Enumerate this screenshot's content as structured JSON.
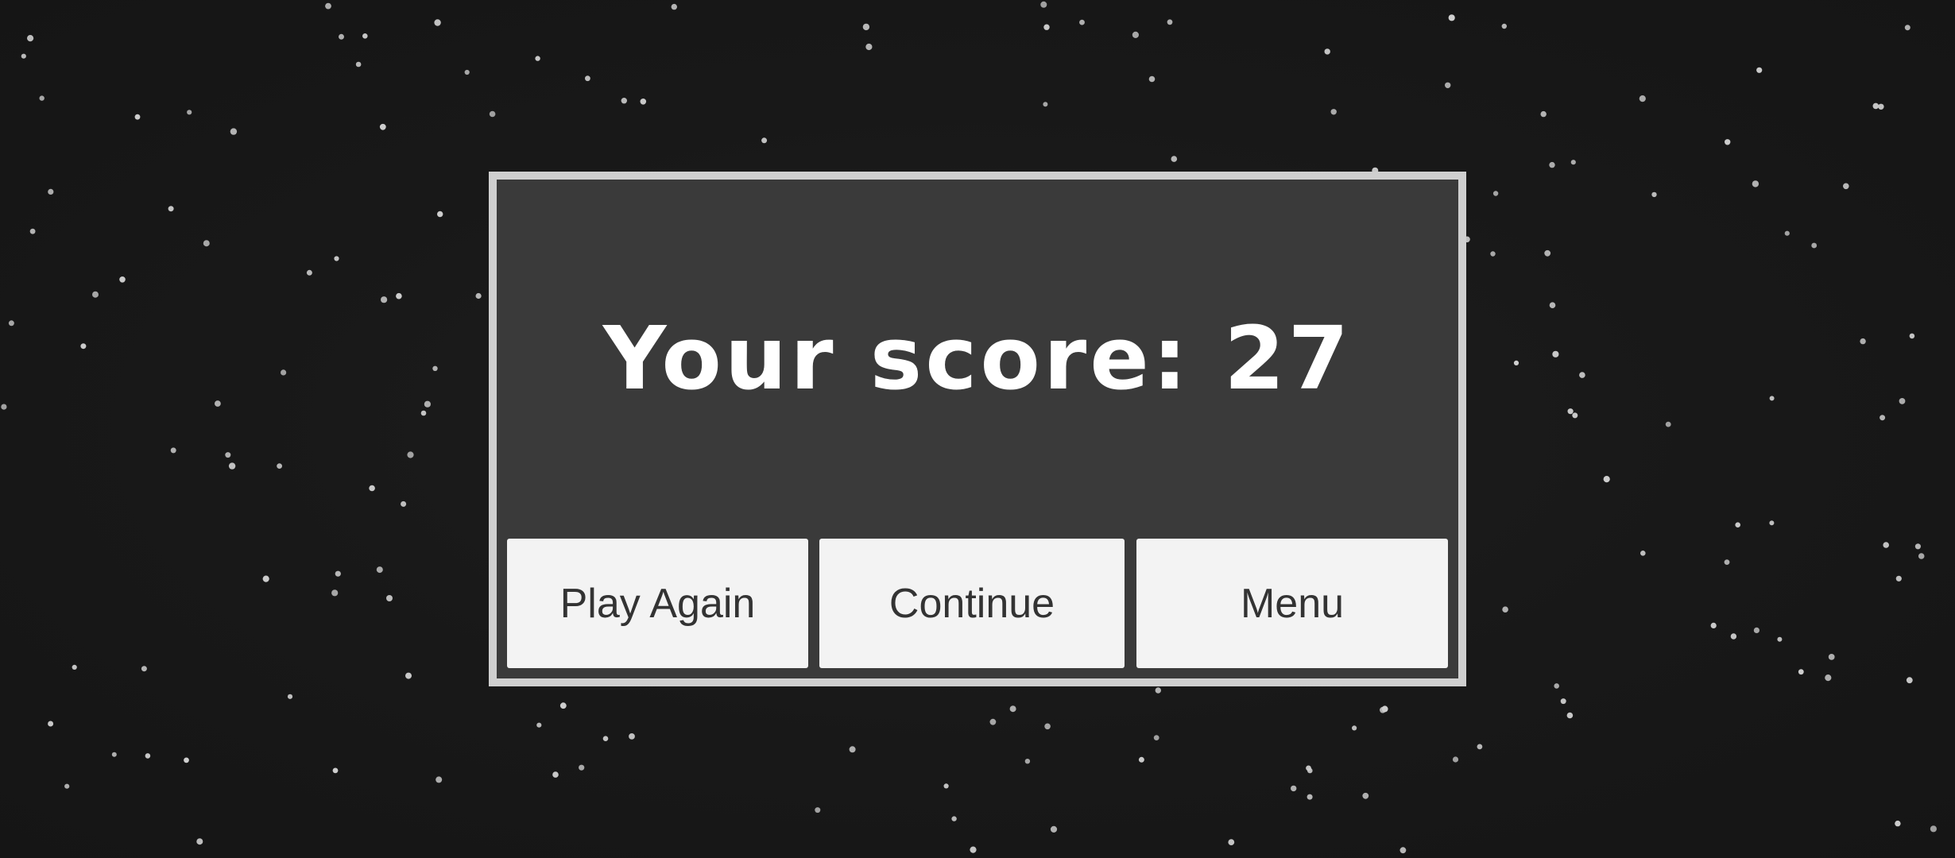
{
  "dialog": {
    "score_text": "Your score: 27",
    "score": 27
  },
  "buttons": {
    "play_again": "Play Again",
    "continue": "Continue",
    "menu": "Menu"
  },
  "colors": {
    "background": "#181818",
    "dialog_border": "#cfcfcf",
    "dialog_fill": "#3a3a3a",
    "button_fill": "#f3f3f3",
    "button_text": "#333333",
    "star": "#cfcfcf"
  }
}
